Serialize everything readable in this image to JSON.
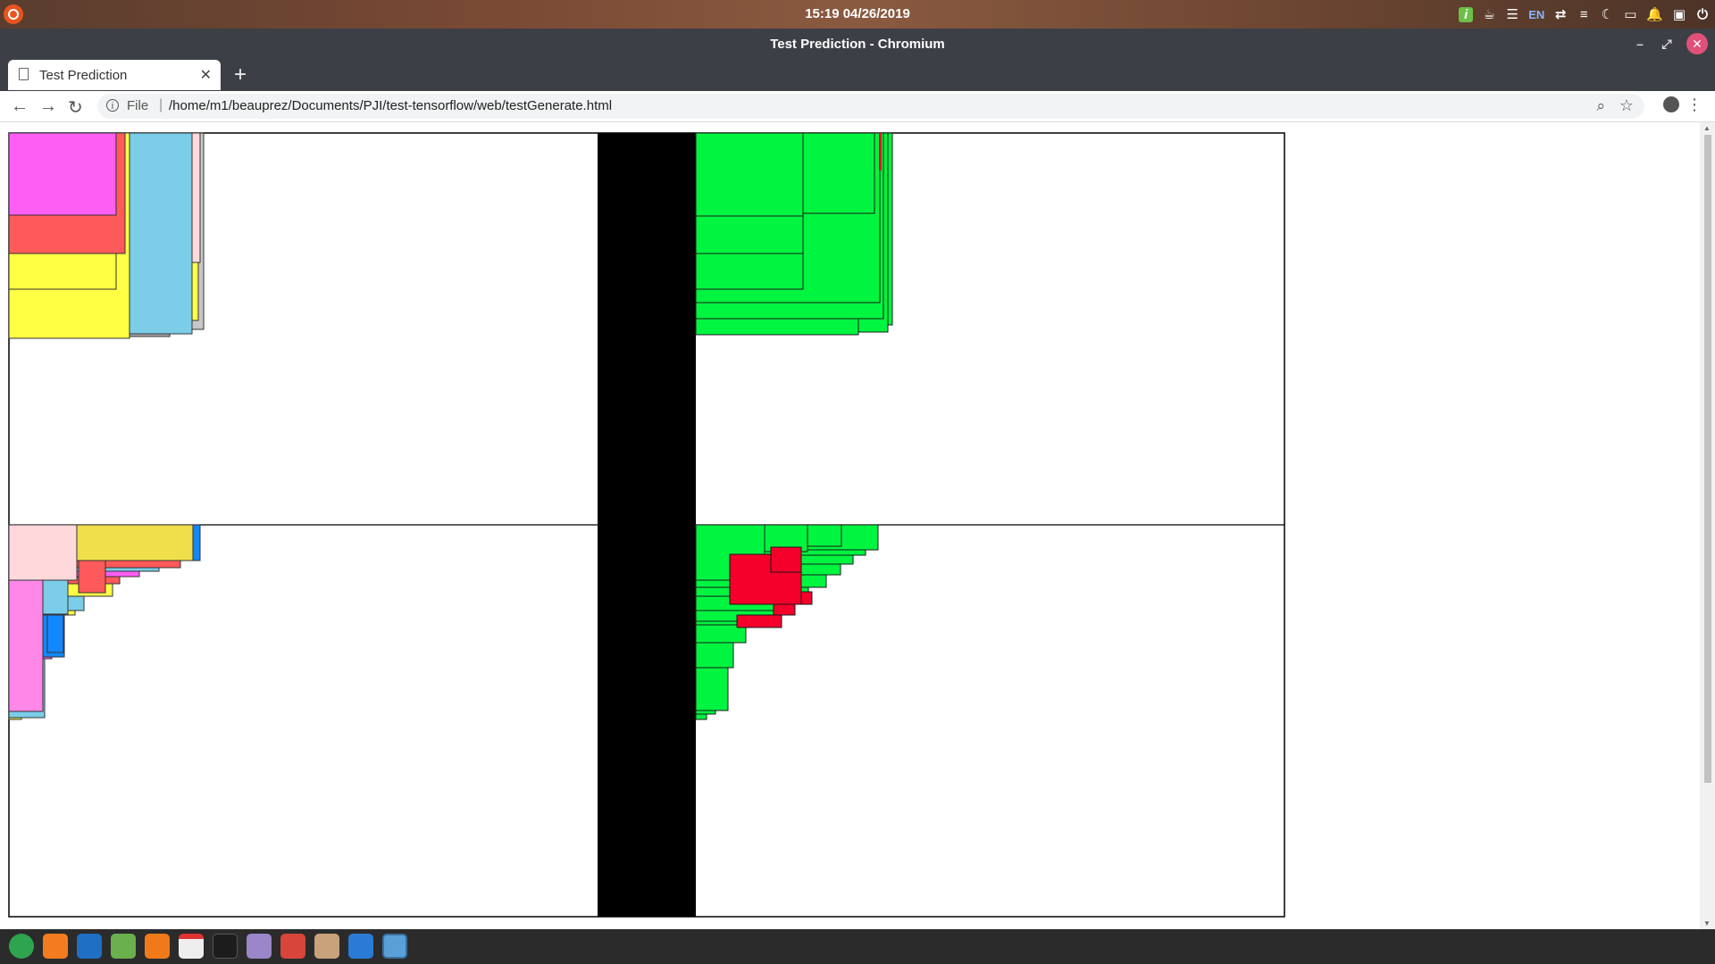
{
  "system": {
    "clock": "15:19 04/26/2019",
    "tray_lang": "EN"
  },
  "window": {
    "title": "Test Prediction - Chromium"
  },
  "tabs": [
    {
      "label": "Test Prediction"
    }
  ],
  "address": {
    "scheme_label": "File",
    "url": "/home/m1/beauprez/Documents/PJI/test-tensorflow/web/testGenerate.html"
  },
  "colors": {
    "pink": "#ff5ef5",
    "salmon": "#ff5a5a",
    "yellow": "#ffff44",
    "sky": "#7bcde8",
    "lightpink": "#ffd8dc",
    "mustard": "#f0df4a",
    "blue": "#1188ff",
    "green": "#00f540",
    "red": "#f5002a"
  },
  "dock_apps": [
    "chromium",
    "firefox",
    "vscode",
    "atom",
    "media-player",
    "calendar",
    "terminal",
    "files",
    "image-viewer",
    "java",
    "text-editor",
    "screenshot"
  ]
}
